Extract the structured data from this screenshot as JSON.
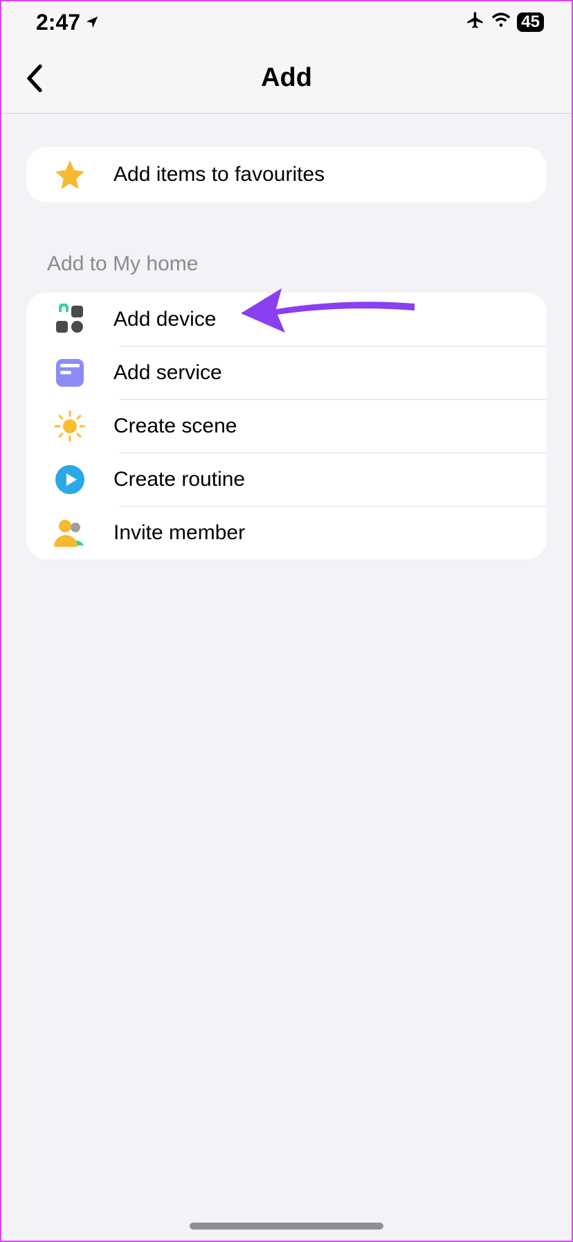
{
  "status_bar": {
    "time": "2:47",
    "battery": "45"
  },
  "header": {
    "title": "Add"
  },
  "favourites": {
    "label": "Add items to favourites"
  },
  "section": {
    "label": "Add to My home"
  },
  "rows": {
    "add_device": "Add device",
    "add_service": "Add service",
    "create_scene": "Create scene",
    "create_routine": "Create routine",
    "invite_member": "Invite member"
  }
}
